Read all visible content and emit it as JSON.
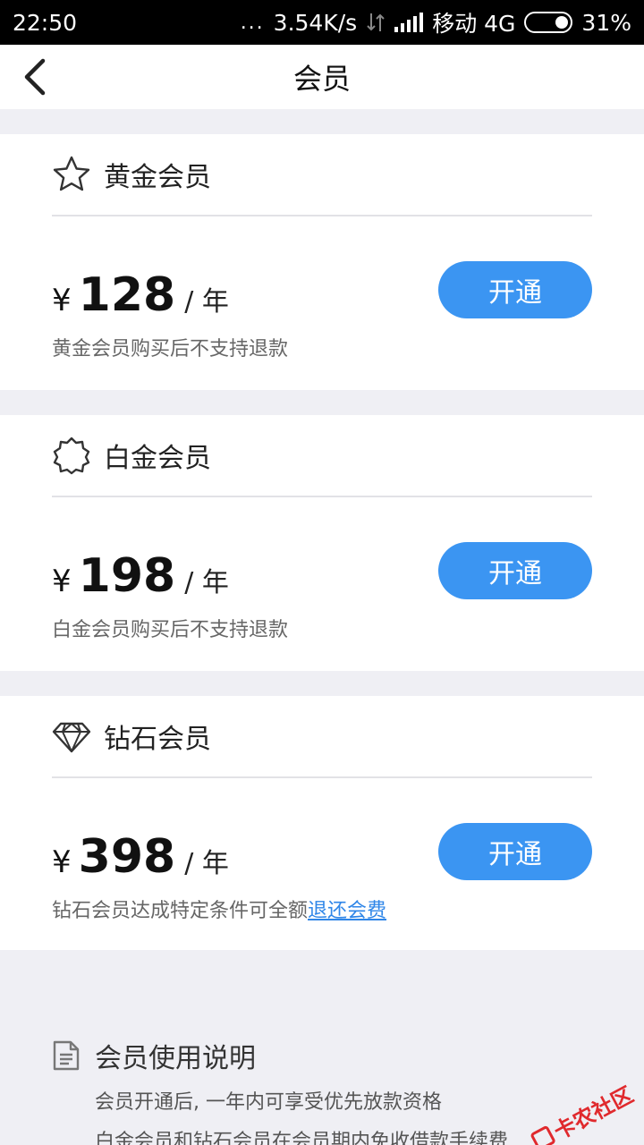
{
  "status_bar": {
    "time": "22:50",
    "dots": "...",
    "net_speed": "3.54K/s",
    "carrier": "移动 4G",
    "battery": "31%"
  },
  "nav": {
    "title": "会员"
  },
  "tiers": [
    {
      "name": "黄金会员",
      "icon": "star-icon",
      "currency": "¥",
      "price": "128",
      "unit": "/ 年",
      "button": "开通",
      "note": "黄金会员购买后不支持退款"
    },
    {
      "name": "白金会员",
      "icon": "badge-icon",
      "currency": "¥",
      "price": "198",
      "unit": "/ 年",
      "button": "开通",
      "note": "白金会员购买后不支持退款"
    },
    {
      "name": "钻石会员",
      "icon": "diamond-icon",
      "currency": "¥",
      "price": "398",
      "unit": "/ 年",
      "button": "开通",
      "note": "钻石会员达成特定条件可全额",
      "note_link": "退还会费"
    }
  ],
  "info": {
    "title": "会员使用说明",
    "lines": [
      "会员开通后, 一年内可享受优先放款资格",
      "白金会员和钻石会员在会员期内免收借款手续费"
    ]
  },
  "watermark": "卡农社区",
  "colors": {
    "accent": "#3b95f2",
    "link": "#2f86e8",
    "background": "#efeff4"
  }
}
